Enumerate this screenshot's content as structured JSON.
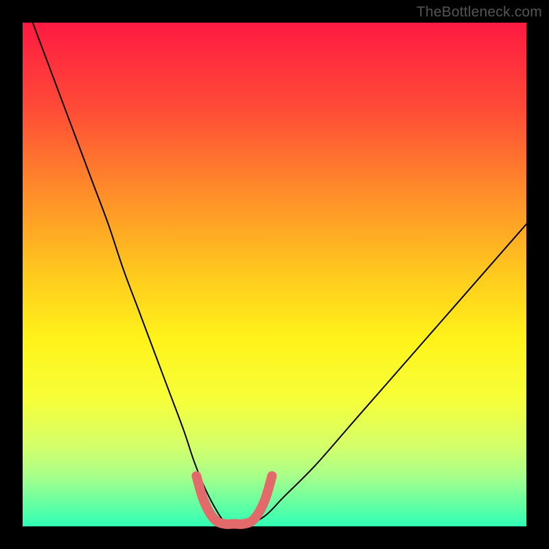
{
  "watermark": "TheBottleneck.com",
  "chart_data": {
    "type": "line",
    "title": "",
    "xlabel": "",
    "ylabel": "",
    "xlim": [
      0,
      100
    ],
    "ylim": [
      0,
      100
    ],
    "grid": false,
    "legend": false,
    "annotations": [],
    "background_gradient": {
      "description": "vertical gradient over plot area, red at top through orange/yellow to green at bottom",
      "stops": [
        {
          "offset": 0.0,
          "color": "#ff1a42"
        },
        {
          "offset": 0.17,
          "color": "#ff4b37"
        },
        {
          "offset": 0.33,
          "color": "#ff8a2a"
        },
        {
          "offset": 0.5,
          "color": "#ffca1e"
        },
        {
          "offset": 0.63,
          "color": "#fff31a"
        },
        {
          "offset": 0.75,
          "color": "#f6ff3a"
        },
        {
          "offset": 0.84,
          "color": "#d4ff6a"
        },
        {
          "offset": 0.9,
          "color": "#a8ff8a"
        },
        {
          "offset": 0.95,
          "color": "#6cffa0"
        },
        {
          "offset": 1.0,
          "color": "#2fffb4"
        }
      ]
    },
    "series": [
      {
        "name": "bottleneck-curve",
        "comment": "V-shaped curve; y is mismatch/bottleneck magnitude (100=top, 0=bottom). Values estimated from pixel positions since no axis ticks are shown.",
        "stroke": "#000000",
        "stroke_width": 2,
        "x": [
          2,
          5,
          8,
          11,
          14,
          17,
          20,
          23,
          26,
          29,
          32,
          34,
          36,
          38,
          40,
          42,
          44,
          48,
          52,
          58,
          65,
          72,
          79,
          86,
          93,
          100
        ],
        "y": [
          100,
          92,
          84,
          76,
          68,
          60,
          51,
          43,
          35,
          27,
          19,
          13,
          8,
          4,
          1,
          0,
          0,
          2,
          6,
          12,
          20,
          28,
          36,
          44,
          52,
          60
        ]
      },
      {
        "name": "optimal-band-marker",
        "comment": "Thick pink U-shaped marker highlighting the valley of the curve (optimal match region).",
        "stroke": "#e36a6a",
        "stroke_width": 14,
        "x": [
          34.5,
          36,
          38,
          40,
          42,
          44,
          46,
          48,
          49.5
        ],
        "y": [
          10,
          5,
          1.5,
          0.5,
          0.5,
          0.5,
          1.5,
          5,
          10
        ]
      }
    ]
  }
}
